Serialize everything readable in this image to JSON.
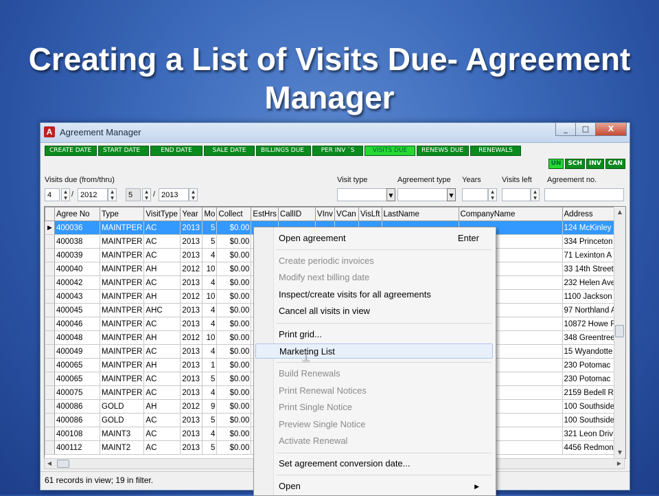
{
  "slide": {
    "title_line1": "Creating a List of Visits Due- Agreement",
    "title_line2": "Manager"
  },
  "window": {
    "title": "Agreement Manager",
    "icon_letter": "A",
    "buttons": {
      "minimize": "_",
      "maximize": "□",
      "close": "X"
    }
  },
  "filter_tabs": [
    "CREATE DATE",
    "START DATE",
    "END DATE",
    "SALE DATE",
    "BILLINGS DUE",
    "PER INV `S",
    "VISITS DUE",
    "RENEWS DUE",
    "RENEWALS"
  ],
  "active_filter": "VISITS DUE",
  "status_tabs": [
    "UN",
    "SCH",
    "INV",
    "CAN"
  ],
  "criteria": {
    "visits_due_label": "Visits due (from/thru)",
    "from_month": "4",
    "from_year": "2012",
    "thru_month": "5",
    "thru_year": "2013",
    "slash": "/",
    "visit_type_label": "Visit type",
    "agreement_type_label": "Agreement type",
    "years_label": "Years",
    "visits_left_label": "Visits left",
    "agreement_no_label": "Agreement no."
  },
  "grid": {
    "columns": [
      "Agree No",
      "Type",
      "VisitType",
      "Year",
      "Mo",
      "Collect",
      "EstHrs",
      "CallID",
      "VInv",
      "VCan",
      "VisLft",
      "LastName",
      "CompanyName",
      "Address"
    ],
    "rows": [
      {
        "agree": "400036",
        "type": "MAINTPER",
        "visit": "AC",
        "year": "2013",
        "mo": "5",
        "collect": "$0.00",
        "address": "124 McKinley"
      },
      {
        "agree": "400038",
        "type": "MAINTPER",
        "visit": "AC",
        "year": "2013",
        "mo": "5",
        "collect": "$0.00",
        "address": "334 Princeton"
      },
      {
        "agree": "400039",
        "type": "MAINTPER",
        "visit": "AC",
        "year": "2013",
        "mo": "4",
        "collect": "$0.00",
        "address": "71 Lexinton A"
      },
      {
        "agree": "400040",
        "type": "MAINTPER",
        "visit": "AH",
        "year": "2012",
        "mo": "10",
        "collect": "$0.00",
        "address": "33 14th Street"
      },
      {
        "agree": "400042",
        "type": "MAINTPER",
        "visit": "AC",
        "year": "2013",
        "mo": "4",
        "collect": "$0.00",
        "address": "232 Helen Ave"
      },
      {
        "agree": "400043",
        "type": "MAINTPER",
        "visit": "AH",
        "year": "2012",
        "mo": "10",
        "collect": "$0.00",
        "address": "1100 Jackson"
      },
      {
        "agree": "400045",
        "type": "MAINTPER",
        "visit": "AHC",
        "year": "2013",
        "mo": "4",
        "collect": "$0.00",
        "address": "97 Northland A"
      },
      {
        "agree": "400046",
        "type": "MAINTPER",
        "visit": "AC",
        "year": "2013",
        "mo": "4",
        "collect": "$0.00",
        "address": "10872 Howe F"
      },
      {
        "agree": "400048",
        "type": "MAINTPER",
        "visit": "AH",
        "year": "2012",
        "mo": "10",
        "collect": "$0.00",
        "address": "348 Greentree"
      },
      {
        "agree": "400049",
        "type": "MAINTPER",
        "visit": "AC",
        "year": "2013",
        "mo": "4",
        "collect": "$0.00",
        "address": "15 Wyandotte"
      },
      {
        "agree": "400065",
        "type": "MAINTPER",
        "visit": "AH",
        "year": "2013",
        "mo": "1",
        "collect": "$0.00",
        "address": "230 Potomac"
      },
      {
        "agree": "400065",
        "type": "MAINTPER",
        "visit": "AC",
        "year": "2013",
        "mo": "5",
        "collect": "$0.00",
        "address": "230 Potomac"
      },
      {
        "agree": "400075",
        "type": "MAINTPER",
        "visit": "AC",
        "year": "2013",
        "mo": "4",
        "collect": "$0.00",
        "address": "2159 Bedell R"
      },
      {
        "agree": "400086",
        "type": "GOLD",
        "visit": "AH",
        "year": "2012",
        "mo": "9",
        "collect": "$0.00",
        "address": "100 Southside"
      },
      {
        "agree": "400086",
        "type": "GOLD",
        "visit": "AC",
        "year": "2013",
        "mo": "5",
        "collect": "$0.00",
        "address": "100 Southside"
      },
      {
        "agree": "400108",
        "type": "MAINT3",
        "visit": "AC",
        "year": "2013",
        "mo": "4",
        "collect": "$0.00",
        "address": "321 Leon Driv"
      },
      {
        "agree": "400112",
        "type": "MAINT2",
        "visit": "AC",
        "year": "2013",
        "mo": "5",
        "collect": "$0.00",
        "address": "4456 Redmon"
      }
    ]
  },
  "status": {
    "text": "61 records in view; 19 in filter."
  },
  "context_menu": {
    "items": [
      {
        "label": "Open agreement",
        "shortcut": "Enter",
        "disabled": false
      },
      {
        "label": "Create periodic invoices",
        "disabled": true
      },
      {
        "label": "Modify next billing date",
        "disabled": true
      },
      {
        "label": "Inspect/create visits for all agreements",
        "disabled": false
      },
      {
        "label": "Cancel all visits in view",
        "disabled": false
      },
      {
        "label": "Print grid...",
        "disabled": false
      },
      {
        "label": "Marketing List",
        "disabled": false
      },
      {
        "label": "Build Renewals",
        "disabled": true
      },
      {
        "label": "Print Renewal Notices",
        "disabled": true
      },
      {
        "label": "Print Single Notice",
        "disabled": true
      },
      {
        "label": "Preview Single Notice",
        "disabled": true
      },
      {
        "label": "Activate Renewal",
        "disabled": true
      },
      {
        "label": "Set agreement conversion date...",
        "disabled": false
      },
      {
        "label": "Open",
        "disabled": false
      }
    ],
    "highlighted": "Marketing List"
  },
  "colors": {
    "tab_green": "#0b8a1e",
    "tab_active_green": "#27d833",
    "selection_blue": "#3399ff",
    "slide_background": "#3f6dbd"
  }
}
